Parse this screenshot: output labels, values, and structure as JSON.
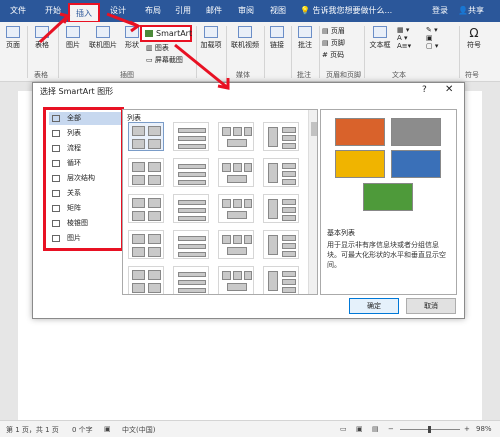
{
  "tabs": [
    "文件",
    "开始",
    "插入",
    "设计",
    "布局",
    "引用",
    "邮件",
    "审阅",
    "视图"
  ],
  "tell_me": "告诉我您想要做什么...",
  "account": {
    "login": "登录",
    "share": "共享"
  },
  "ribbon": {
    "page": "页面",
    "table": "表格",
    "pictures": "图片",
    "online_pictures": "联机图片",
    "shapes": "形状",
    "smartart": "SmartArt",
    "chart": "图表",
    "screenshot": "屏幕截图",
    "addins": "加载项",
    "online_video": "联机视频",
    "links": "链接",
    "comment": "批注",
    "header": "页眉",
    "footer": "页脚",
    "page_number": "页码",
    "text_box": "文本框",
    "symbol": "符号",
    "groups": {
      "tables": "表格",
      "illustrations": "插图",
      "media": "媒体",
      "comments": "批注",
      "header_footer": "页眉和页脚",
      "text": "文本",
      "symbols": "符号"
    }
  },
  "dialog": {
    "title": "选择 SmartArt 图形",
    "help": "?",
    "close": "✕",
    "categories": [
      "全部",
      "列表",
      "流程",
      "循环",
      "层次结构",
      "关系",
      "矩阵",
      "棱锥图",
      "图片"
    ],
    "selected_category": "全部",
    "gallery_label": "列表",
    "preview_title": "基本列表",
    "preview_desc": "用于显示非有序信息块或者分组信息块。可最大化形状的水平和垂直显示空间。",
    "preview_colors": [
      "#d9622b",
      "#8c8c8c",
      "#f0b400",
      "#3a70b8",
      "#4e9a3a"
    ],
    "ok": "确定",
    "cancel": "取消"
  },
  "status": {
    "page": "第 1 页，共 1 页",
    "words": "0 个字",
    "language": "中文(中国)",
    "zoom": "98%"
  }
}
